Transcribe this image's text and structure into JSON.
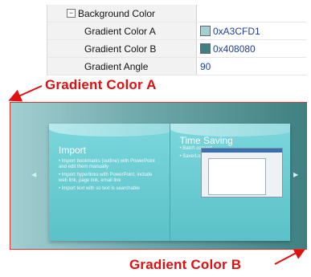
{
  "property_grid": {
    "group_label": "Background Color",
    "rows": [
      {
        "label": "Gradient Color A",
        "value": "0xA3CFD1",
        "swatch": "#A3CFD1"
      },
      {
        "label": "Gradient Color B",
        "value": "0x408080",
        "swatch": "#408080"
      },
      {
        "label": "Gradient Angle",
        "value": "90"
      }
    ]
  },
  "annotations": {
    "gradient_a": "Gradient Color A",
    "gradient_b": "Gradient Color B"
  },
  "preview": {
    "left_page_title": "Import",
    "left_page_bullets": [
      "• Import bookmarks (outline) with PowerPoint and edit them manually",
      "• Import hyperlinks with PowerPoint, include web link, page link, email link",
      "• Import text with so text is searchable"
    ],
    "right_page_title": "Time Saving",
    "right_page_bullets": [
      "• Batch convert",
      "• Save/Load Settings"
    ]
  },
  "colors": {
    "annotation_red": "#e01010",
    "gradient_a": "#A3CFD1",
    "gradient_b": "#408080"
  }
}
